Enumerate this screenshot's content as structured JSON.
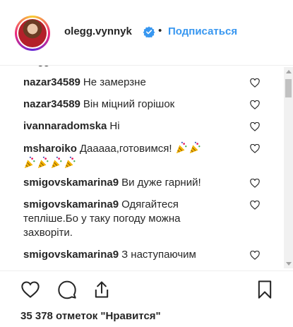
{
  "header": {
    "username": "olegg.vynnyk",
    "separator": "•",
    "follow_label": "Подписаться"
  },
  "comments": [
    {
      "author": "nazar34589",
      "text": "Не замерзне"
    },
    {
      "author": "nazar34589",
      "text": "Він міцний горішок"
    },
    {
      "author": "ivannaradomska",
      "text": "Ні"
    },
    {
      "author": "msharoiko",
      "text": "Дааааа,готовимся!"
    },
    {
      "author": "smigovskamarina9",
      "text": "Ви дуже гарний!"
    },
    {
      "author": "smigovskamarina9",
      "text": "Одягайтеся тепліше.Бо у таку погоду можна захворіти."
    },
    {
      "author": "smigovskamarina9",
      "text": "З наступаючим"
    }
  ],
  "likes_text": "35 378 отметок \"Нравится\"",
  "icons": {
    "verified": "verified-badge-icon",
    "heart": "heart-outline-icon",
    "comment": "comment-bubble-icon",
    "share": "share-icon",
    "bookmark": "bookmark-icon",
    "emoji": "party-popper-emoji"
  },
  "colors": {
    "follow": "#3897f0",
    "text": "#262626",
    "verified": "#3897f0"
  }
}
